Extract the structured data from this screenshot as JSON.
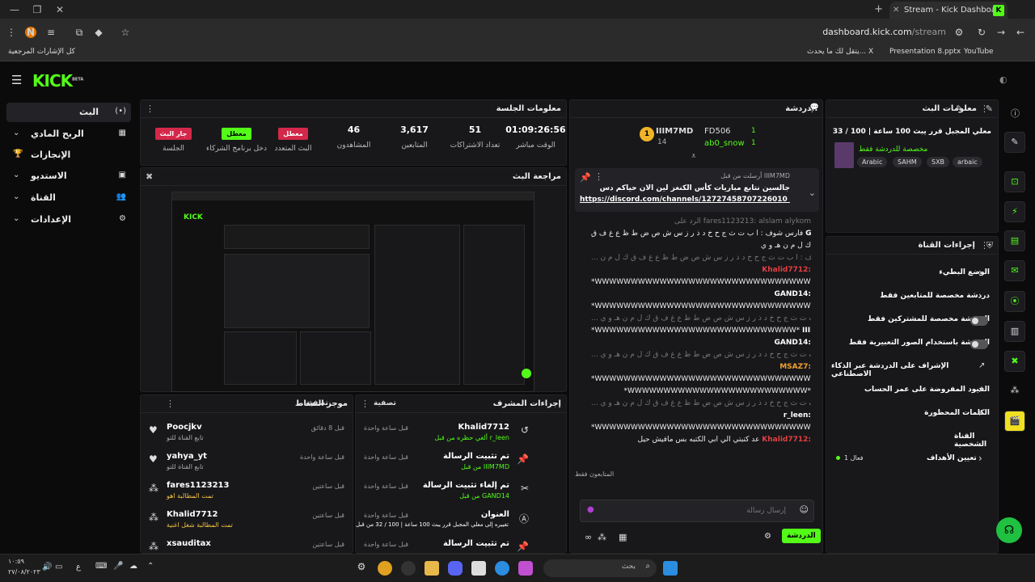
{
  "browser": {
    "tab_title": "Stream - Kick Dashboard",
    "url_host": "dashboard.kick.com",
    "url_path": "/stream",
    "profile_initial": "N",
    "bookmarks": [
      "كل الإشارات المرجعية",
      "يتقل لك ما يحدث... X",
      "Presentation 8.pptx",
      "YouTube"
    ]
  },
  "brand": {
    "logo": "KICK",
    "logo_sup": "BETA",
    "accent": "#53fc18"
  },
  "leftnav": {
    "items": [
      {
        "label": "البث",
        "icon": "(•)"
      },
      {
        "label": "الربح المادي",
        "icon": "▦"
      },
      {
        "label": "الإنجازات",
        "icon": "🏆"
      },
      {
        "label": "الاستديو",
        "icon": "▣"
      },
      {
        "label": "القناة",
        "icon": "👥"
      },
      {
        "label": "الإعدادات",
        "icon": "⚙"
      }
    ]
  },
  "session": {
    "title": "معلومات الجلسة",
    "stats": [
      {
        "value": "01:09:26:56",
        "label": "الوقت مباشر"
      },
      {
        "value": "51",
        "label": "تعداد الاشتراكات"
      },
      {
        "value": "3,617",
        "label": "المتابعين"
      },
      {
        "value": "46",
        "label": "المشاهدون"
      },
      {
        "badge": "معطل",
        "label": "البث المتعدد"
      },
      {
        "badge": "معطل",
        "label": "دخل برنامج الشركاء"
      },
      {
        "badge": "جار البث",
        "label": "الجلسة"
      }
    ]
  },
  "preview": {
    "title": "مراجعة البث"
  },
  "chat": {
    "title": "الدردشة",
    "top_users": [
      {
        "name": "IIIM7MD",
        "count": "14"
      },
      {
        "name": "FD506",
        "count": "1"
      },
      {
        "name": "ab0_snow",
        "count": "1"
      }
    ],
    "pinned": {
      "by": "أرسلت من قبل IIIM7MD",
      "text": "جالسين نتابع مباريات كأس الكنغز لين الان حياكم دس",
      "link": "https://discord.com/channels/12727458707226010 51/127..."
    },
    "lines": [
      {
        "text": "الرد على fares1123213: alslam alykom",
        "dim": true
      },
      {
        "user": "GAND14:",
        "text": "فارس شوف : ا ب ت ث ج ح خ د ذ ر ز س ش ص ض ط ظ ع غ ف ق",
        "color": "#fff"
      },
      {
        "text": "ك ل م ن هـ و ي",
        "dim": false
      },
      {
        "text": "... فارس شوف : ا ب ت ث ج ح خ د ذ ر ز س ش ص ض ط ظ ع غ ف ق ك ل م ن",
        "dim": true
      },
      {
        "user": "Khalid7712:",
        "text": "",
        "color": "#e04040"
      },
      {
        "text": "*WWWWWWWWWWWWWWWWWWWWWWWWWWWWWWWWW*",
        "dim": false
      },
      {
        "user": "GAND14:",
        "text": "",
        "color": "#fff"
      },
      {
        "text": "*WWWWWWWWWWWWWWWWWWWWWWWWWWWWWWWWWWWWWW*",
        "dim": false
      },
      {
        "text": "... فارس شوف : ا ب ت ث ج ح خ د ذ ر ز س ش ص ض ط ظ ع غ ف ق ك ل م ن هـ و ي",
        "dim": true
      },
      {
        "user": "IIIM7MD:",
        "text": "*WWWWWWWWWWWWWWWWWWWWWWWWWWWW*",
        "color": "#fff"
      },
      {
        "user": "GAND14:",
        "text": "",
        "color": "#fff"
      },
      {
        "text": "... فارس شوف : ا ب ت ث ج ح خ د ذ ر ز س ش ص ض ط ظ ع غ ف ق ك ل م ن هـ و ي",
        "dim": true
      },
      {
        "user": "MSAZ7:",
        "text": "",
        "color": "#f0a030"
      },
      {
        "text": "*WWWWWWWWWWWWWWWWWWWWWWWWWWWWWWWWWWWWW*",
        "dim": false
      },
      {
        "text": "*WWWWWWWWWWWWWWWWWWWWWWWWW*",
        "dim": false
      },
      {
        "text": "... فارس شوف : ا ب ت ث ج ح خ د ذ ر ز س ش ص ض ط ظ ع غ ف ق ك ل م ن هـ و ي",
        "dim": true
      },
      {
        "user": "r_leen:",
        "text": "",
        "color": "#fff"
      },
      {
        "text": "*WWWWWWWWWWWWWWWWWWWWWWWWWWWWWW*",
        "dim": false
      },
      {
        "user": "Khalid7712:",
        "text": "عد كتبتي الي ابي الكتبه بس مافيش حيل",
        "color": "#e04040"
      }
    ],
    "followers_only": "المتابعون فقط",
    "input_placeholder": "إرسال رسالة",
    "send_label": "الدردشة"
  },
  "stream_info": {
    "title": "معلومات البث",
    "stream_title": "معلي المجبل قرر يبث 100 ساعة | 100 / 33",
    "subtitle": "مخصصة للدردشة فقط",
    "tags": [
      "Arabic",
      "SAHM",
      "SXB",
      "arbaic"
    ]
  },
  "channel_actions": {
    "title": "إجراءات القناة",
    "items": [
      {
        "label": "الوضع البطيء",
        "type": "chevron"
      },
      {
        "label": "دردشة مخصصة للمتابعين فقط",
        "type": "chevron"
      },
      {
        "label": "الدردشة مخصصة للمشتركين فقط",
        "type": "switch"
      },
      {
        "label": "الدردشة باستخدام الصور التعبيرية فقط",
        "type": "switch"
      },
      {
        "label": "الإشراف على الدردشة عبر الذكاء الاصطناعي",
        "type": "link"
      },
      {
        "label": "القيود المفروضة على عمر الحساب",
        "type": "chevron"
      },
      {
        "label": "الكلمات المحظورة",
        "type": "chevron"
      }
    ],
    "personal": "القناة الشخصية",
    "goals": "تعيين الأهداف",
    "goals_value": "فعال 1"
  },
  "mod_actions": {
    "title": "إجراءات المشرف",
    "filter": "تصفية",
    "rows": [
      {
        "name": "Khalid7712",
        "sub": "ألغي حظره من قبل r_leen",
        "time": "قبل ساعة واحدة",
        "icon": "↺"
      },
      {
        "name": "تم تثبيت الرسالة",
        "sub": "من قبل IIIM7MD",
        "time": "قبل ساعة واحدة",
        "icon": "📌"
      },
      {
        "name": "تم إلغاء تثبيت الرسالة",
        "sub": "من قبل GAND14",
        "time": "قبل ساعة واحدة",
        "icon": "✂"
      },
      {
        "name": "العنوان",
        "sub": "تم تغييره إلى معلي المجبل قرر يبث 100 ساعة | 100 / 32 من قبل IIIceed",
        "time": "قبل ساعة واحدة",
        "icon": "Ⓐ"
      },
      {
        "name": "تم تثبيت الرسالة",
        "sub": "",
        "time": "قبل ساعة واحدة",
        "icon": "📌"
      }
    ]
  },
  "activity": {
    "title": "موجز النشاط",
    "filter": "تصفية",
    "rows": [
      {
        "name": "Poocjkv",
        "sub": "تابع القناة للتو",
        "time": "قبل 8 دقائق",
        "icon": "♥"
      },
      {
        "name": "yahya_yt",
        "sub": "تابع القناة للتو",
        "time": "قبل ساعة واحدة",
        "icon": "♥"
      },
      {
        "name": "fares1123213",
        "sub": "تمت المطالبة اهو",
        "time": "قبل ساعتين",
        "icon": "⁂"
      },
      {
        "name": "Khalid7712",
        "sub": "تمت المطالبة شغل اغنية",
        "time": "قبل ساعتين",
        "icon": "⁂"
      },
      {
        "name": "xsauditax",
        "sub": "",
        "time": "قبل ساعتين",
        "icon": "⁂"
      }
    ]
  },
  "taskbar": {
    "search": "بحث",
    "time": "١٠:٥٩",
    "date": "٢٧/٠٨/٢٠٢٣",
    "lang": "ع"
  }
}
